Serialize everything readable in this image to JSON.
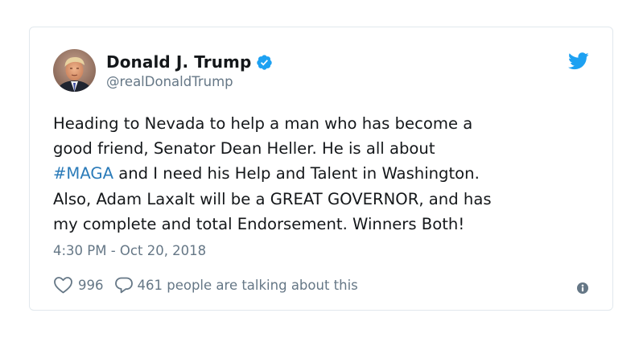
{
  "tweet": {
    "author_name": "Donald J. Trump",
    "handle": "@realDonaldTrump",
    "avatar_icon": "profile-photo",
    "verified_icon": "verified-badge-icon",
    "brand_icon": "twitter-bird-icon",
    "text": {
      "line1": "Heading to Nevada to help a man who has become a",
      "line2": "good friend, Senator Dean Heller. He is all about",
      "hashtag": "#MAGA",
      "line3_rest": " and I need his Help and Talent in Washington.",
      "line4": "Also, Adam Laxalt will be a GREAT GOVERNOR, and has",
      "line5": "my complete and total Endorsement. Winners Both!"
    },
    "timestamp": "4:30 PM - Oct 20, 2018",
    "likes": "996",
    "replies_text": "461 people are talking about this"
  },
  "colors": {
    "accent": "#1da1f2",
    "link": "#2b7bb9",
    "muted": "#657786",
    "text": "#14171a",
    "border": "#e1e8ed"
  }
}
